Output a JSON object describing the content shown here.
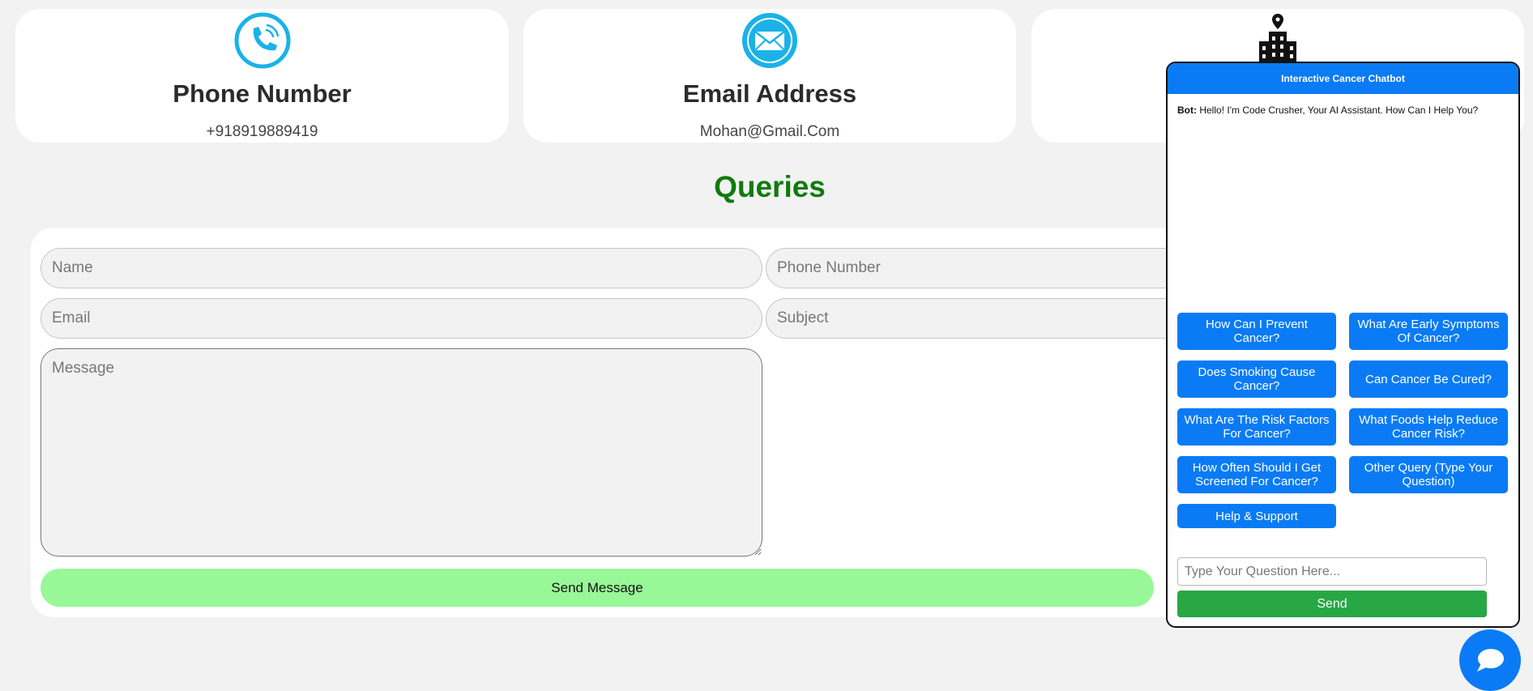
{
  "contacts": [
    {
      "title": "Phone Number",
      "value": "+918919889419",
      "icon": "phone-icon"
    },
    {
      "title": "Email Address",
      "value": "Mohan@Gmail.Com",
      "icon": "email-icon"
    },
    {
      "title": "",
      "value": "",
      "icon": "office-building-location-icon"
    }
  ],
  "queries": {
    "title": "Queries",
    "name_placeholder": "Name",
    "phone_placeholder": "Phone Number",
    "email_placeholder": "Email",
    "subject_placeholder": "Subject",
    "message_placeholder": "Message",
    "send_label": "Send Message"
  },
  "chatbot": {
    "title": "Interactive Cancer Chatbot",
    "bot_prefix": "Bot:",
    "greeting": "Hello! I'm Code Crusher, Your AI Assistant. How Can I Help You?",
    "options": [
      "How Can I Prevent Cancer?",
      "What Are Early Symptoms Of Cancer?",
      "Does Smoking Cause Cancer?",
      "Can Cancer Be Cured?",
      "What Are The Risk Factors For Cancer?",
      "What Foods Help Reduce Cancer Risk?",
      "How Often Should I Get Screened For Cancer?",
      "Other Query (Type Your Question)",
      "Help & Support"
    ],
    "input_placeholder": "Type Your Question Here...",
    "send_label": "Send"
  },
  "colors": {
    "accent_blue": "#0a7bf5",
    "queries_green": "#117a0f",
    "send_message_bg": "#98f898",
    "chat_send_green": "#28a745",
    "icon_cyan": "#1ab2e8"
  },
  "fab": {
    "icon": "chat-bubble-icon"
  }
}
